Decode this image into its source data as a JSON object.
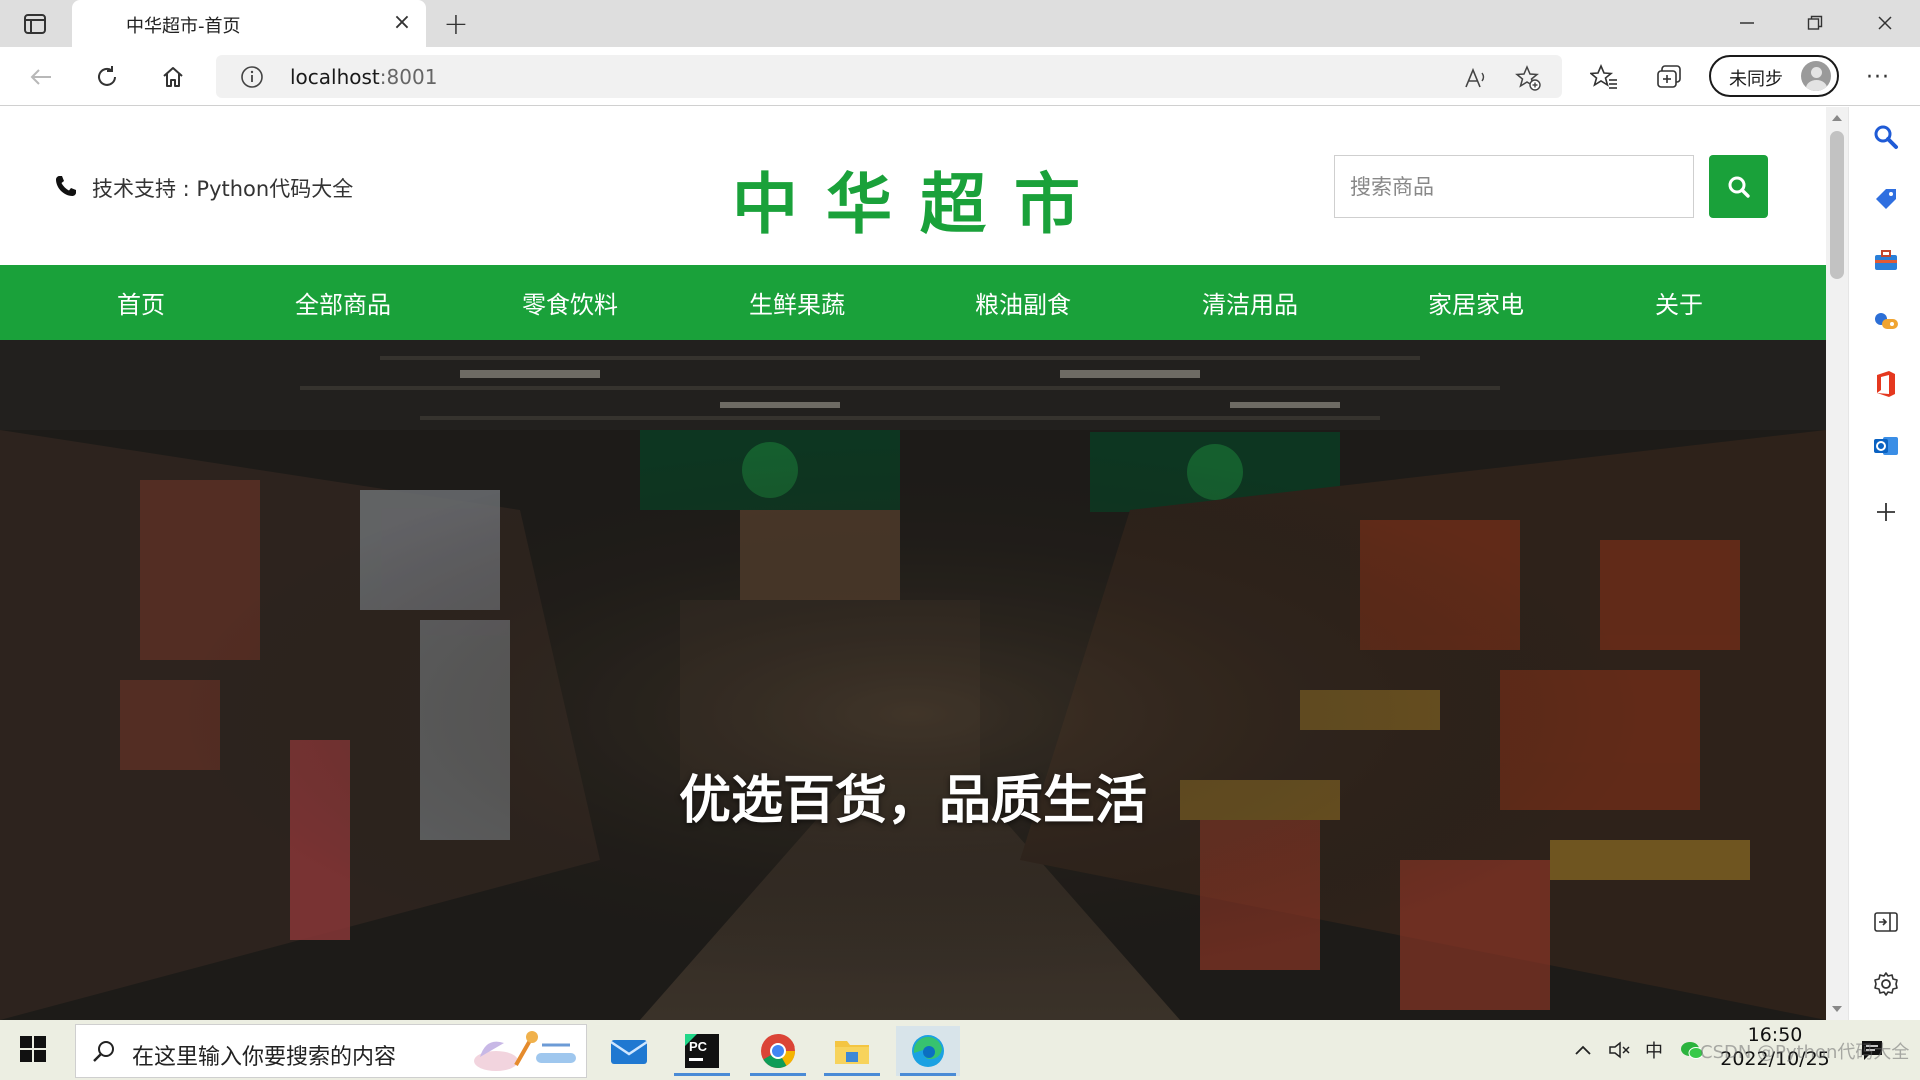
{
  "browser": {
    "tab_title": "中华超市-首页",
    "address": {
      "host": "localhost",
      "port": ":8001"
    },
    "profile_label": "未同步"
  },
  "site": {
    "support_text": "技术支持 : Python代码大全",
    "brand": "中华超市",
    "search_placeholder": "搜索商品",
    "nav": [
      {
        "label": "首页"
      },
      {
        "label": "全部商品"
      },
      {
        "label": "零食饮料"
      },
      {
        "label": "生鲜果蔬"
      },
      {
        "label": "粮油副食"
      },
      {
        "label": "清洁用品"
      },
      {
        "label": "家居家电"
      },
      {
        "label": "关于"
      }
    ],
    "hero_caption": "优选百货，品质生活",
    "accent_color": "#1aa13a"
  },
  "taskbar": {
    "search_placeholder": "在这里输入你要搜索的内容",
    "time": "16:50",
    "date": "2022/10/25",
    "ime": "中",
    "watermark": "CSDN @Python代码大全"
  }
}
